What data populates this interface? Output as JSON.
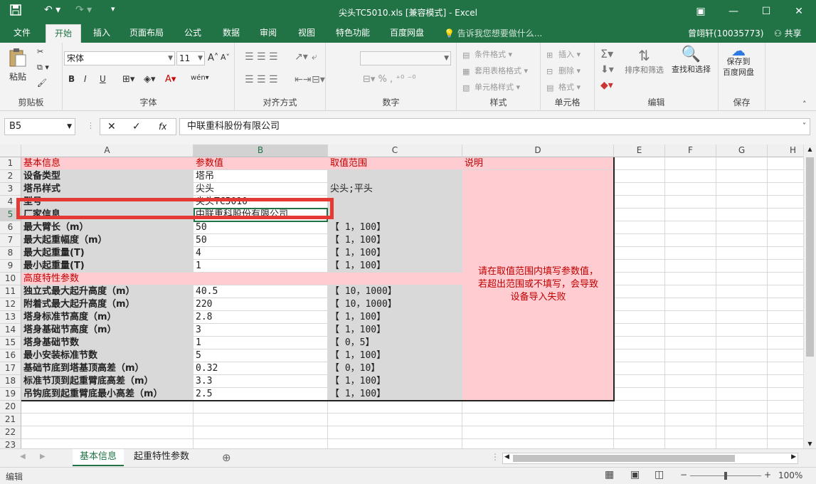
{
  "window": {
    "title": "尖头TC5010.xls [兼容模式] - Excel"
  },
  "ribbon_tabs": [
    "文件",
    "开始",
    "插入",
    "页面布局",
    "公式",
    "数据",
    "审阅",
    "视图",
    "特色功能",
    "百度网盘"
  ],
  "tell_me": "告诉我您想要做什么...",
  "user": "曾翊轩(10035773)",
  "share": "共享",
  "ribbon": {
    "clipboard": {
      "paste": "粘贴",
      "label": "剪贴板"
    },
    "font": {
      "name": "宋体",
      "size": "11",
      "bold": "B",
      "italic": "I",
      "underline": "U",
      "label": "字体"
    },
    "alignment": {
      "label": "对齐方式"
    },
    "number": {
      "label": "数字"
    },
    "styles": {
      "cond": "条件格式",
      "table": "套用表格格式",
      "cell": "单元格样式",
      "label": "样式"
    },
    "cells": {
      "insert": "插入",
      "delete": "删除",
      "format": "格式",
      "label": "单元格"
    },
    "editing": {
      "sort": "排序和筛选",
      "find": "查找和选择",
      "label": "编辑"
    },
    "save": {
      "btn": "保存到\n百度网盘",
      "label": "保存"
    }
  },
  "name_box": "B5",
  "formula": "中联重科股份有限公司",
  "columns": [
    "A",
    "B",
    "C",
    "D",
    "E",
    "F",
    "G",
    "H"
  ],
  "rows": [
    [
      "基本信息",
      "参数值",
      "取值范围",
      "说明"
    ],
    [
      "设备类型",
      "塔吊",
      "",
      ""
    ],
    [
      "塔吊样式",
      "尖头",
      "尖头;平头",
      ""
    ],
    [
      "型号",
      "尖头TC5010",
      "",
      ""
    ],
    [
      "厂家信息",
      "中联重科股份有限公司",
      "",
      ""
    ],
    [
      "最大臂长（m）",
      "50",
      "【 1，100】",
      ""
    ],
    [
      "最大起重幅度（m）",
      "50",
      "【 1，100】",
      ""
    ],
    [
      "最大起重量(T)",
      "4",
      "【 1，100】",
      ""
    ],
    [
      "最小起重量(T)",
      "1",
      "【 1，100】",
      ""
    ],
    [
      "高度特性参数",
      "",
      "",
      ""
    ],
    [
      "独立式最大起升高度（m）",
      "40.5",
      "【 10，1000】",
      ""
    ],
    [
      "附着式最大起升高度（m）",
      "220",
      "【 10，1000】",
      ""
    ],
    [
      "塔身标准节高度（m）",
      "2.8",
      "【 1，100】",
      ""
    ],
    [
      "塔身基础节高度（m）",
      "3",
      "【 1，100】",
      ""
    ],
    [
      "塔身基础节数",
      "1",
      "【 0，5】",
      ""
    ],
    [
      "最小安装标准节数",
      "5",
      "【 1，100】",
      ""
    ],
    [
      "基础节底到塔基顶高差（m）",
      "0.32",
      "【 0，10】",
      ""
    ],
    [
      "标准节顶到起重臂底高差（m）",
      "3.3",
      "【 1，100】",
      ""
    ],
    [
      "吊钩底到起重臂底最小高差（m）",
      "2.5",
      "【 1，100】",
      ""
    ]
  ],
  "note": "请在取值范围内填写参数值，\n若超出范围或不填写，会导致\n设备导入失败",
  "row_numbers": [
    "1",
    "2",
    "3",
    "4",
    "5",
    "6",
    "7",
    "8",
    "9",
    "10",
    "11",
    "12",
    "13",
    "14",
    "15",
    "16",
    "17",
    "18",
    "19",
    "20",
    "21",
    "22",
    "23"
  ],
  "sheet_tabs": [
    "基本信息",
    "起重特性参数"
  ],
  "status": {
    "mode": "编辑",
    "zoom": "100%"
  },
  "colors": {
    "green": "#217346",
    "pink": "#ffccd1",
    "red_text": "#c00000",
    "highlight": "#e53935"
  }
}
